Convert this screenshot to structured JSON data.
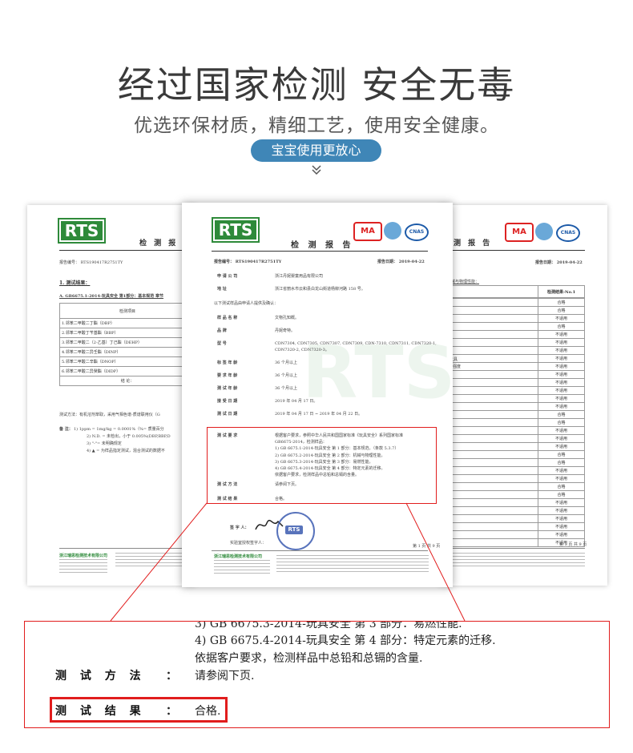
{
  "header": {
    "title": "经过国家检测 安全无毒",
    "subtitle": "优选环保材质，精细工艺，使用安全健康。",
    "pill_label": "宝宝使用更放心",
    "chevron_glyph": "≫"
  },
  "left_doc": {
    "logo": "RTS",
    "heading": "检 测 报",
    "report_no": "报告编号： RTS190417R2751TY",
    "section_title": "1. 测试结果：",
    "subsection": "A. GB6675.1-2014-玩具安全 第1部分：基本规范 章节",
    "col_header": "检测项目",
    "rows": [
      "1.邻苯二甲酸二丁酯（DBP）",
      "2.邻苯二甲酸丁苄基酯（BBP）",
      "3.邻苯二甲酸二（2-乙基）丁己酯（DEHP）",
      "4.邻苯二甲酸二异壬酯（DINP）",
      "5.邻苯二甲酸二辛酯（DNOP）",
      "6.邻苯二甲酸二异癸酯（DIDP）",
      "结 论："
    ],
    "method": "测试方法：有机溶剂萃取，采用气相色谱-质谱联用仪（G",
    "note_label": "备 注：",
    "notes": [
      "1) 1ppm = 1mg/kg = 0.0001%（%= 质量百分",
      "2) N.D. = 未检出，小于 0.005%(DBP,BBP,D",
      "3) \"-\"= 未明确规定",
      "4) ▲ = 为样品指定测试，混合测试的数据不"
    ],
    "company": "浙江瑞思检测技术有限公司"
  },
  "center_doc": {
    "logo": "RTS",
    "heading": "检 测 报 告",
    "report_no": "报告编号： RTS190417R2751TY",
    "report_date": "报告日期： 2019-04-22",
    "fields": [
      {
        "label": "申 请 公 司",
        "value": "浙江丹妮婴童用品有限公司"
      },
      {
        "label": "地 址",
        "value": "浙江省丽水市云和县白龙山街道杨柳河路 158 号。"
      }
    ],
    "confirm_line": "以下测试样品由申请人提供及确认：",
    "sample_fields": [
      {
        "label": "样 品 名 称",
        "value": "文物孔知概。"
      },
      {
        "label": "品 牌",
        "value": "丹妮奇特。"
      },
      {
        "label": "型 号",
        "value": "CDN7304, CDN7305, CDN7307, CDN7309, CDN-7310, CDN7311, CDN7320-1, CDN7320-2, CDN7320-3。"
      },
      {
        "label": "标 签 年 龄",
        "value": "36 个月以上"
      },
      {
        "label": "要 求 年 龄",
        "value": "36 个月以上"
      },
      {
        "label": "测 试 年 龄",
        "value": "36 个月以上"
      },
      {
        "label": "接 受 日 期",
        "value": "2019 年 04 月 17 日。"
      },
      {
        "label": "测 试 日 期",
        "value": "2019 年 04 月 17 日 ~ 2019 年 04 月 22 日。"
      }
    ],
    "req_label": "测 试 要 求",
    "req_lines": [
      "根据客户要求，参照中华人民共和国国家标准《玩具安全》系列国家标准",
      "GB6675-2014，检测样品：",
      "1) GB 6675.1-2014-玩具安全 第 1 部分：基本规范。（条款 5.3.7）",
      "2) GB 6675.2-2014-玩具安全 第 2 部分：机械与物理性能。",
      "3) GB 6675.3-2014-玩具安全 第 3 部分：易燃性能。",
      "4) GB 6675.4-2014-玩具安全 第 4 部分：特定元素的迁移。",
      "依据客户要求，检测样品中总铅和总镉的含量。"
    ],
    "method_label": "测 试 方 法",
    "method_value": "请参阅下页。",
    "result_label": "测 试 结 果",
    "result_value": "合格。",
    "signer_label": "签 字 人：",
    "approver_label": "实验室授权签字人：",
    "page": "第 1 页 共 9 页",
    "company": "浙江瑞思检测技术有限公司",
    "stamp_text": "RTS",
    "watermark": "RTS",
    "cert_marks": [
      "MA",
      "ilac-MRA",
      "CNAS"
    ]
  },
  "right_doc": {
    "logo": "RTS",
    "heading": "测 报 告",
    "report_date": "报告日期： 2019-04-22",
    "section": "机械与物理性能：",
    "col_header": "检测结果-No.1",
    "results": [
      "合格",
      "合格",
      "不适用",
      "合格",
      "不适用",
      "不适用",
      "不适用",
      "不适用",
      "不适用",
      "不适用",
      "不适用",
      "不适用",
      "不适用",
      "不适用",
      "合格",
      "合格",
      "不适用",
      "不适用",
      "不适用",
      "合格",
      "合格",
      "不适用",
      "不适用",
      "合格",
      "合格",
      "不适用",
      "不适用",
      "不适用",
      "不适用",
      "不适用",
      "不适用"
    ],
    "side_notes": [
      "的玩具",
      "伸强度"
    ],
    "page": "第 3 页 共 9 页",
    "cert_marks": [
      "MA",
      "ilac-MRA",
      "CNAS"
    ]
  },
  "zoom": {
    "cut_line": "3) GB 6675.3-2014-玩具安全 第 3 部分：易燃性能.",
    "line4": "4) GB 6675.4-2014-玩具安全 第 4 部分：特定元素的迁移.",
    "line5": "依据客户要求，检测样品中总铅和总镉的含量.",
    "method_label": "测 试 方 法",
    "method_colon": "：",
    "method_value": "请参阅下页.",
    "result_label": "测 试 结 果",
    "result_colon": "：",
    "result_value": "合格."
  },
  "colors": {
    "accent_red": "#e11d1d",
    "pill_blue": "#3f86b7",
    "rts_green": "#2e8a3a"
  }
}
